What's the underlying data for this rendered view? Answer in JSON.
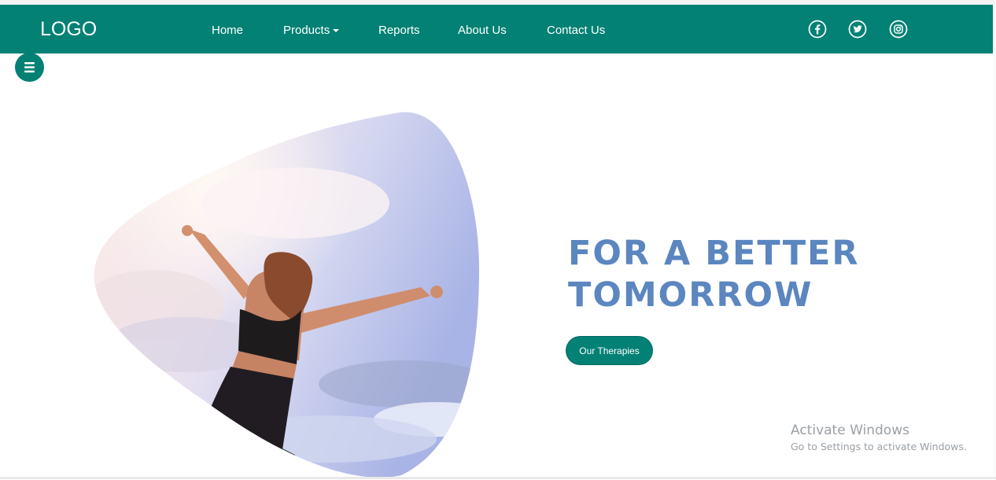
{
  "brand": {
    "logo_text": "LOGO"
  },
  "nav": {
    "items": [
      {
        "label": "Home"
      },
      {
        "label": "Products"
      },
      {
        "label": "Reports"
      },
      {
        "label": "About Us"
      },
      {
        "label": "Contact Us"
      }
    ]
  },
  "social": [
    "facebook-icon",
    "twitter-icon",
    "instagram-icon"
  ],
  "hero": {
    "headline_line1": "FOR A BETTER",
    "headline_line2": "TOMORROW",
    "cta_label": "Our Therapies"
  },
  "watermark": {
    "title": "Activate Windows",
    "subtitle": "Go to Settings to activate Windows."
  },
  "colors": {
    "primary": "#038174",
    "headline": "#5b86c0",
    "watermark": "#9aa0a6"
  }
}
